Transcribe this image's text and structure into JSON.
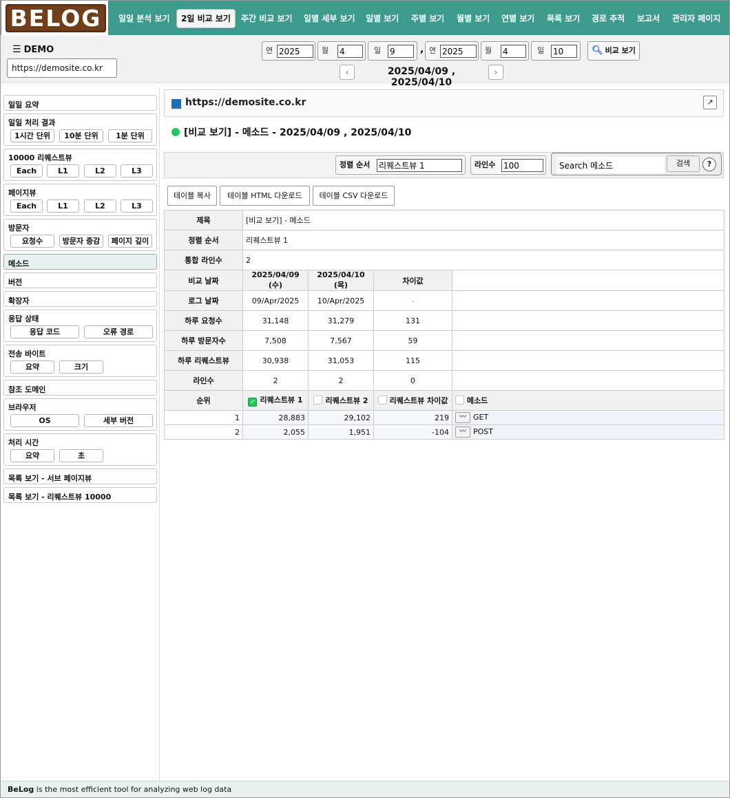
{
  "nav": {
    "logo": "BELOG",
    "items": [
      "일일 분석 보기",
      "2일 비교 보기",
      "주간 비교 보기",
      "일별 세부 보기",
      "일별 보기",
      "주별 보기",
      "월별 보기",
      "연별 보기",
      "목록 보기",
      "경로 추적",
      "보고서",
      "관리자 페이지"
    ],
    "active_index": 1
  },
  "header": {
    "menu_icon": "hamburger-icon",
    "title": "DEMO",
    "site": "https://demosite.co.kr",
    "date1": {
      "year_label": "연",
      "year": "2025",
      "month_label": "월",
      "month": "4",
      "day_label": "일",
      "day": "9"
    },
    "separator": ",",
    "date2": {
      "year_label": "연",
      "year": "2025",
      "month_label": "월",
      "month": "4",
      "day_label": "일",
      "day": "10"
    },
    "compare_label": "비교 보기",
    "range": "2025/04/09 , 2025/04/10",
    "prev": "‹",
    "next": "›"
  },
  "sidebar": {
    "daily_summary": "일일 요약",
    "daily_result": {
      "title": "일일 처리 결과",
      "buttons": [
        "1시간 단위",
        "10분 단위",
        "1분 단위"
      ]
    },
    "requests10000": {
      "title": "10000 리퀘스트뷰",
      "buttons": [
        "Each",
        "L1",
        "L2",
        "L3"
      ]
    },
    "pageview": {
      "title": "페이지뷰",
      "buttons": [
        "Each",
        "L1",
        "L2",
        "L3"
      ]
    },
    "visitors": {
      "title": "방문자",
      "buttons": [
        "요청수",
        "방문자 증감",
        "페이지 깊이"
      ]
    },
    "method": "메소드",
    "version": "버전",
    "extension": "확장자",
    "response": {
      "title": "응답 상태",
      "buttons": [
        "응답 코드",
        "오류 경로"
      ]
    },
    "bytes": {
      "title": "전송 바이트",
      "buttons": [
        "요약",
        "크기"
      ]
    },
    "referer": "참조 도메인",
    "browser": {
      "title": "브라우저",
      "buttons": [
        "OS",
        "세부 버전"
      ]
    },
    "proctime": {
      "title": "처리 시간",
      "buttons": [
        "요약",
        "초"
      ]
    },
    "list_subpage": "목록 보기 - 서브 페이지뷰",
    "list_req": "목록 보기 - 리퀘스트뷰 10000"
  },
  "main": {
    "site_title": "https://demosite.co.kr",
    "expand_icon": "↗",
    "subtitle": "[비교 보기] - 메소드 - 2025/04/09 , 2025/04/10",
    "sort_label": "정렬 순서",
    "sort_value": "리퀘스트뷰 1",
    "lines_label": "라인수",
    "lines_value": "100",
    "search_placeholder": "Search 메소드",
    "search_btn": "검색",
    "help": "?",
    "table_buttons": [
      "테이블 복사",
      "테이블 HTML 다운로드",
      "테이블 CSV 다운로드"
    ]
  },
  "info": {
    "title_label": "제목",
    "title_value": "[비교 보기] - 메소드",
    "sort_label": "정렬 순서",
    "sort_value": "리퀘스트뷰 1",
    "lines_label": "통합 라인수",
    "lines_value": "2"
  },
  "compare": {
    "headers": [
      "비교 날짜",
      "2025/04/09 (수)",
      "2025/04/10 (목)",
      "차이값"
    ],
    "rows": [
      [
        "로그 날짜",
        "09/Apr/2025",
        "10/Apr/2025",
        "-"
      ],
      [
        "하루 요청수",
        "31,148",
        "31,279",
        "131"
      ],
      [
        "하루 방문자수",
        "7,508",
        "7,567",
        "59"
      ],
      [
        "하루 리퀘스트뷰",
        "30,938",
        "31,053",
        "115"
      ],
      [
        "라인수",
        "2",
        "2",
        "0"
      ]
    ]
  },
  "list": {
    "headers": [
      "순위",
      "리퀘스트뷰 1",
      "리퀘스트뷰 2",
      "리퀘스트뷰 차이값",
      "메소드"
    ],
    "rows": [
      [
        "1",
        "28,883",
        "29,102",
        "219",
        "GET"
      ],
      [
        "2",
        "2,055",
        "1,951",
        "-104",
        "POST"
      ]
    ]
  },
  "footer": {
    "brand": "BeLog",
    "text": " is the most efficient tool for analyzing web log data"
  }
}
